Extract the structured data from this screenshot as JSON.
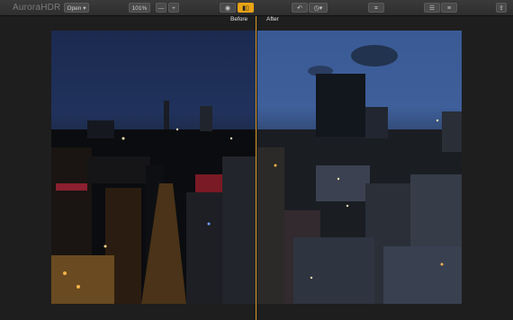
{
  "app": {
    "logo_text": "AuroraHDR"
  },
  "toolbar": {
    "open_label": "Open ▾",
    "zoom_level": "101%",
    "zoom_minus": "—",
    "zoom_plus": "+"
  },
  "viewer": {
    "before_label": "Before",
    "after_label": "After"
  },
  "colors": {
    "accent": "#e8a316"
  }
}
